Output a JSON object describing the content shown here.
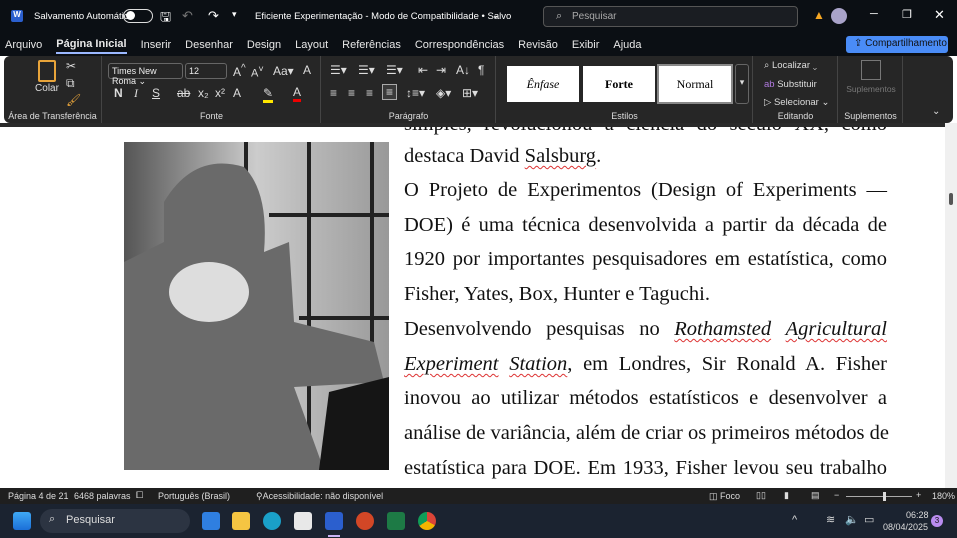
{
  "titlebar": {
    "autosave_label": "Salvamento Automático",
    "doc_title": "Eficiente Experimentação - Modo de Compatibilidade • Salvo",
    "search_placeholder": "Pesquisar"
  },
  "menu": {
    "tabs": [
      "Arquivo",
      "Página Inicial",
      "Inserir",
      "Desenhar",
      "Design",
      "Layout",
      "Referências",
      "Correspondências",
      "Revisão",
      "Exibir",
      "Ajuda"
    ],
    "share_label": "Compartilhamento",
    "active": "Página Inicial"
  },
  "ribbon": {
    "clipboard": {
      "paste": "Colar",
      "label": "Área de Transferência"
    },
    "font": {
      "name": "Times New Roma",
      "size": "12",
      "label": "Fonte",
      "bold": "N",
      "italic": "I",
      "underline": "S"
    },
    "paragraph": {
      "label": "Parágrafo"
    },
    "styles": {
      "items": [
        "Ênfase",
        "Forte",
        "Normal"
      ],
      "label": "Estilos"
    },
    "editing": {
      "find": "Localizar",
      "replace": "Substituir",
      "select": "Selecionar",
      "label": "Editando"
    },
    "addins": {
      "button": "Suplementos",
      "label": "Suplementos"
    }
  },
  "document": {
    "lines": [
      "simples, revolucionou a ciência do século XX, como",
      "destaca David Salsburg.",
      "O Projeto de Experimentos (Design of Experiments —",
      "DOE) é uma técnica desenvolvida a partir da década de",
      "1920 por importantes pesquisadores em estatística, como",
      "Fisher, Yates, Box, Hunter e Taguchi.",
      "Desenvolvendo pesquisas no Rothamsted Agricultural",
      "Experiment Station, em Londres, Sir Ronald A. Fisher",
      "inovou ao utilizar métodos estatísticos e desenvolver a",
      "análise de variância, além de criar os primeiros métodos de",
      "estatística para DOE. Em 1933, Fisher levou seu trabalho"
    ]
  },
  "status": {
    "page": "Página 4 de 21",
    "words": "6468 palavras",
    "language": "Português (Brasil)",
    "accessibility": "Acessibilidade: não disponível",
    "focus": "Foco",
    "zoom": "180%",
    "zoom_percent": 180
  },
  "taskbar": {
    "search": "Pesquisar",
    "time": "06:28",
    "date": "08/04/2025",
    "badge": "3"
  },
  "colors": {
    "accent": "#4a8cf7",
    "ribbon_bg": "#262626",
    "titlebar_bg": "#0b0f14"
  }
}
